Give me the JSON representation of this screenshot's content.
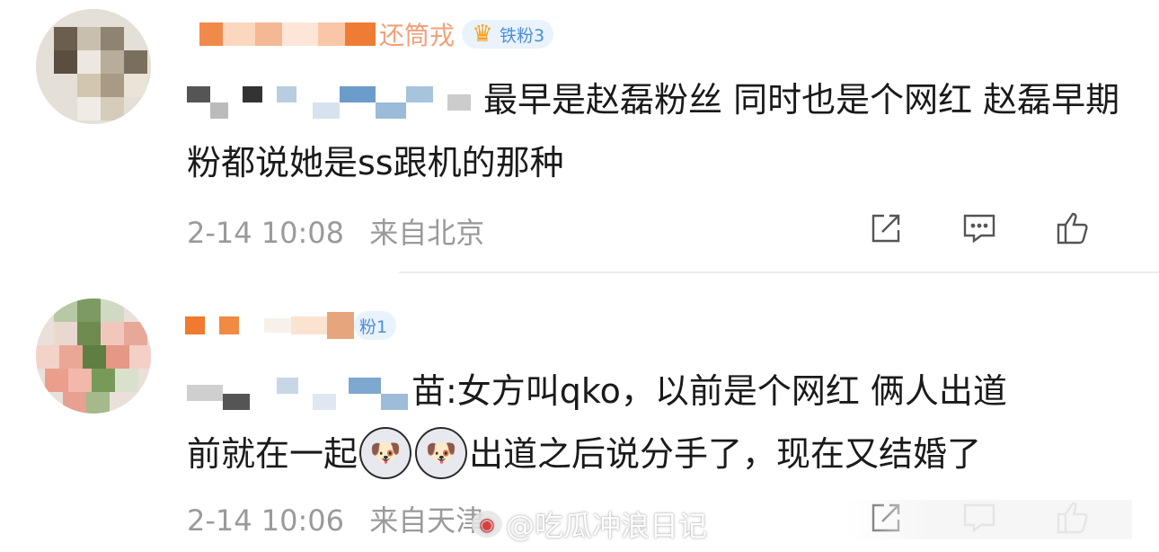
{
  "comments": [
    {
      "username_visible": "还筒戎",
      "badge_label": "铁粉3",
      "text_visible": "最早是赵磊粉丝 同时也是个网红 赵磊早期粉都说她是ss跟机的那种",
      "time": "2-14 10:08",
      "location": "来自北京"
    },
    {
      "username_visible": "",
      "badge_label": "粉1",
      "text_visible_1": "苗:女方叫qko，以前是个网红 俩人出道",
      "text_visible_2a": "前就在一起",
      "text_visible_2b": "出道之后说分手了，现在又结婚了",
      "time": "2-14 10:06",
      "location": "来自天津"
    }
  ],
  "icons": [
    "share-icon",
    "comment-icon",
    "like-icon",
    "crown-icon",
    "husky-emoji-icon",
    "weibo-logo-icon"
  ],
  "watermark": "@吃瓜冲浪日记",
  "colors": {
    "badge_text": "#4a8fd8",
    "badge_bg": "#eaf2fb",
    "meta": "#9a9a9a",
    "crown": "#f2a21c"
  }
}
